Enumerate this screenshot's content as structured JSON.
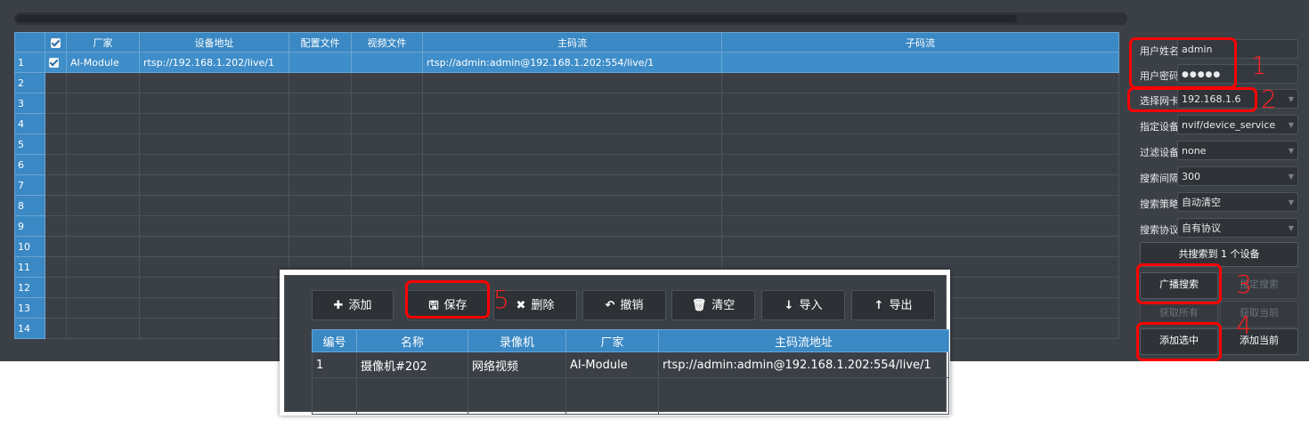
{
  "grid": {
    "headers": [
      "",
      "厂家",
      "设备地址",
      "配置文件",
      "视频文件",
      "主码流",
      "子码流"
    ],
    "rows": [
      {
        "num": "1",
        "checked": true,
        "vendor": "AI-Module",
        "address": "rtsp://192.168.1.202/live/1",
        "config": "",
        "video": "",
        "main": "rtsp://admin:admin@192.168.1.202:554/live/1",
        "sub": ""
      },
      {
        "num": "2"
      },
      {
        "num": "3"
      },
      {
        "num": "4"
      },
      {
        "num": "5"
      },
      {
        "num": "6"
      },
      {
        "num": "7"
      },
      {
        "num": "8"
      },
      {
        "num": "9"
      },
      {
        "num": "10"
      },
      {
        "num": "11"
      },
      {
        "num": "12"
      },
      {
        "num": "13"
      },
      {
        "num": "14"
      }
    ]
  },
  "panel": {
    "username_label": "用户姓名",
    "username": "admin",
    "password_label": "用户密码",
    "password": "●●●●●",
    "nic_label": "选择网卡",
    "nic": "192.168.1.6",
    "device_label": "指定设备",
    "device": "nvif/device_service",
    "filter_label": "过滤设备",
    "filter": "none",
    "interval_label": "搜索间隔",
    "interval": "300",
    "strategy_label": "搜索策略",
    "strategy": "自动清空",
    "protocol_label": "搜索协议",
    "protocol": "自有协议",
    "found_text": "共搜索到 1 个设备",
    "broadcast_btn": "广播搜索",
    "specified_btn": "指定搜索",
    "get_all_btn": "获取所有",
    "get_current_btn": "获取当前",
    "add_selected_btn": "添加选中",
    "add_current_btn": "添加当前"
  },
  "annotations": [
    "1",
    "2",
    "3",
    "4",
    "5"
  ],
  "popup": {
    "toolbar": [
      {
        "icon": "✚",
        "label": "添加"
      },
      {
        "icon": "🖫",
        "label": "保存"
      },
      {
        "icon": "✖",
        "label": "删除"
      },
      {
        "icon": "↶",
        "label": "撤销"
      },
      {
        "icon": "🗑",
        "label": "清空"
      },
      {
        "icon": "↓",
        "label": "导入"
      },
      {
        "icon": "↑",
        "label": "导出"
      }
    ],
    "headers": [
      "编号",
      "名称",
      "录像机",
      "厂家",
      "主码流地址"
    ],
    "rows": [
      {
        "id": "1",
        "name": "摄像机#202",
        "recorder": "网络视频",
        "vendor": "AI-Module",
        "url": "rtsp://admin:admin@192.168.1.202:554/live/1"
      }
    ]
  },
  "colors": {
    "highlight": "#ff0000",
    "header": "#3a88c4",
    "background": "#3b4047"
  }
}
